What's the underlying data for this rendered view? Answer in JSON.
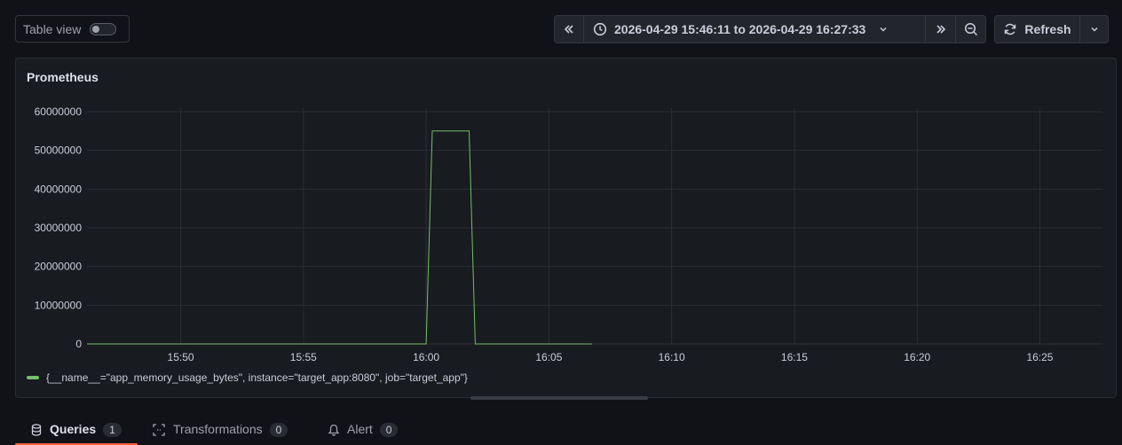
{
  "toolbar": {
    "table_view_label": "Table view",
    "table_view_on": false,
    "time_range": "2026-04-29 15:46:11 to 2026-04-29 16:27:33",
    "refresh_label": "Refresh"
  },
  "panel": {
    "title": "Prometheus"
  },
  "chart_data": {
    "type": "line",
    "y_ticks": [
      "0",
      "10000000",
      "20000000",
      "30000000",
      "40000000",
      "50000000",
      "60000000"
    ],
    "x_ticks": [
      "15:50",
      "15:55",
      "16:00",
      "16:05",
      "16:10",
      "16:15",
      "16:20",
      "16:25"
    ],
    "ylim": [
      0,
      60000000
    ],
    "xlim": [
      "15:46:11",
      "16:27:33"
    ],
    "grid": true,
    "legend_position": "bottom-left",
    "series": [
      {
        "name": "{__name__=\"app_memory_usage_bytes\", instance=\"target_app:8080\", job=\"target_app\"}",
        "color": "#73bf69",
        "x": [
          "15:46:11",
          "16:00:00",
          "16:00:15",
          "16:01:45",
          "16:02:00",
          "16:06:45"
        ],
        "values": [
          0,
          0,
          55000000,
          55000000,
          0,
          0
        ]
      }
    ]
  },
  "tabs": [
    {
      "label": "Queries",
      "count": "1"
    },
    {
      "label": "Transformations",
      "count": "0"
    },
    {
      "label": "Alert",
      "count": "0"
    }
  ]
}
